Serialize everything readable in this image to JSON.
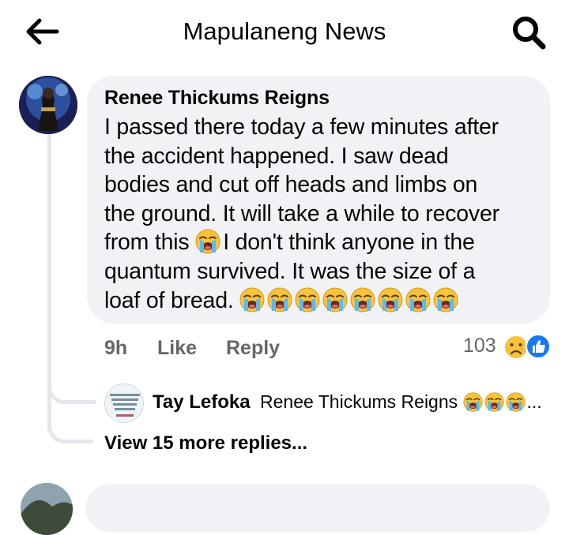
{
  "header": {
    "title": "Mapulaneng News",
    "back_icon": "arrow-left-icon",
    "search_icon": "search-icon"
  },
  "comment": {
    "author": "Renee Thickums Reigns",
    "lines": [
      "I passed there today a few minutes after",
      "the accident happened. I saw dead",
      "bodies and cut off heads and limbs on",
      "the ground. It will take a while to recover",
      "from this",
      "I don't think anyone in the",
      "quantum survived. It was the size of a",
      "loaf of bread."
    ],
    "emoji": "loudly-crying-face",
    "trailing_emoji_count": 8,
    "time": "9h",
    "like_label": "Like",
    "reply_label": "Reply",
    "reaction_count": "103",
    "reaction_icons": [
      "sad-reaction-icon",
      "like-reaction-icon"
    ]
  },
  "reply_preview": {
    "author": "Tay Lefoka",
    "text": "Renee Thickums Reigns",
    "emoji_count": 3,
    "ellipsis": "..."
  },
  "view_more": "View 15 more replies...",
  "colors": {
    "bubble": "#f0f2f5",
    "meta_text": "#65676b",
    "like_blue": "#1877f2",
    "thread_line": "#e4e6eb"
  }
}
